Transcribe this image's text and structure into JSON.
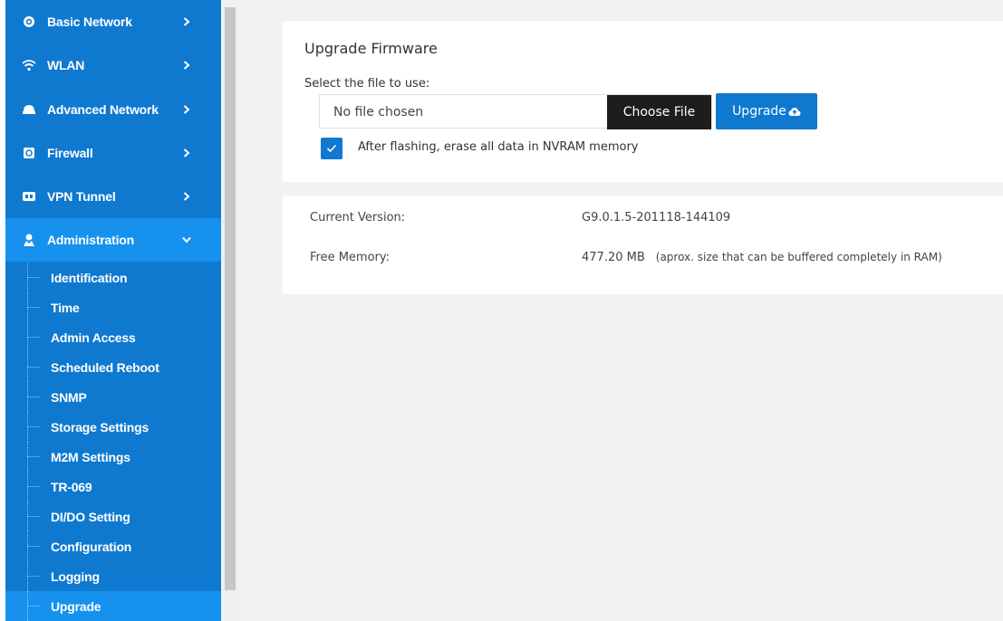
{
  "sidebar": {
    "nav_items": [
      {
        "label": "Basic Network",
        "icon": "globe-icon"
      },
      {
        "label": "WLAN",
        "icon": "wifi-icon"
      },
      {
        "label": "Advanced Network",
        "icon": "network-icon"
      },
      {
        "label": "Firewall",
        "icon": "firewall-icon"
      },
      {
        "label": "VPN Tunnel",
        "icon": "vpn-icon"
      },
      {
        "label": "Administration",
        "icon": "admin-icon"
      }
    ],
    "sub_items": [
      {
        "label": "Identification"
      },
      {
        "label": "Time"
      },
      {
        "label": "Admin Access"
      },
      {
        "label": "Scheduled Reboot"
      },
      {
        "label": "SNMP"
      },
      {
        "label": "Storage Settings"
      },
      {
        "label": "M2M Settings"
      },
      {
        "label": "TR-069"
      },
      {
        "label": "DI/DO Setting"
      },
      {
        "label": "Configuration"
      },
      {
        "label": "Logging"
      },
      {
        "label": "Upgrade"
      }
    ]
  },
  "upgrade_panel": {
    "title": "Upgrade Firmware",
    "file_label": "Select the file to use:",
    "file_input_value": "No file chosen",
    "choose_file_label": "Choose File",
    "upgrade_label": "Upgrade",
    "erase_nvram_checked": true,
    "erase_nvram_label": "After flashing, erase all data in NVRAM memory"
  },
  "info_panel": {
    "current_version_label": "Current Version:",
    "current_version_value": "G9.0.1.5-201118-144109",
    "free_memory_label": "Free Memory:",
    "free_memory_value": "477.20 MB",
    "free_memory_note": "(aprox. size that can be buffered completely in RAM)"
  },
  "colors": {
    "sidebar_bg": "#0f79d0",
    "sidebar_active": "#1691ee",
    "choose_file_bg": "#1d1d1d",
    "accent": "#0f79d0"
  }
}
